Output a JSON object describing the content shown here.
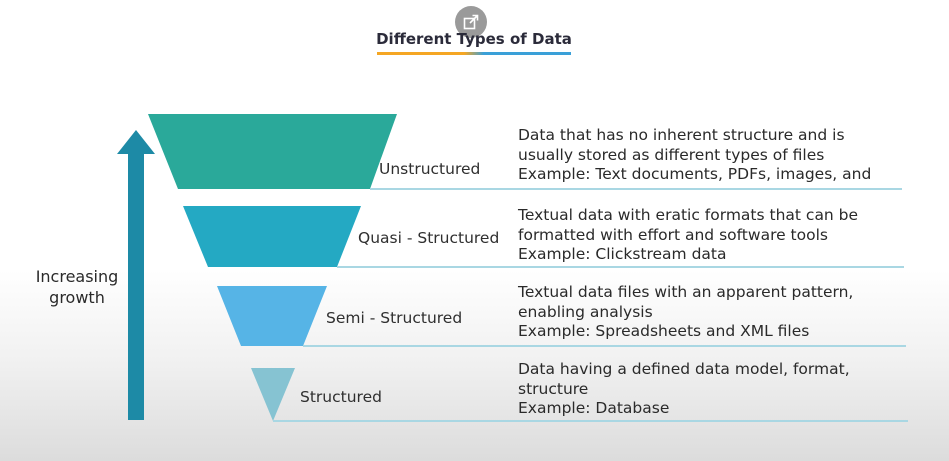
{
  "header": {
    "title": "Different Types of Data",
    "share_icon": "external-link-icon"
  },
  "axis": {
    "line1": "Increasing",
    "line2": "growth",
    "arrow_color": "#1d8aa6"
  },
  "tiers": [
    {
      "label": "Unstructured",
      "color": "#2aa99a",
      "description": [
        "Data that has no inherent structure and is",
        "usually stored as different types of files",
        "Example: Text documents, PDFs, images, and"
      ]
    },
    {
      "label": "Quasi - Structured",
      "color": "#24a9c3",
      "description": [
        "Textual data with eratic formats that can be",
        "formatted with effort and software tools",
        "Example: Clickstream data"
      ]
    },
    {
      "label": "Semi - Structured",
      "color": "#56b4e6",
      "description": [
        "Textual data files with an apparent pattern,",
        "enabling analysis",
        "Example: Spreadsheets and XML files"
      ]
    },
    {
      "label": "Structured",
      "color": "#86c3d2",
      "description": [
        "Data having a defined data model, format,",
        "structure",
        "Example: Database"
      ]
    }
  ],
  "colors": {
    "divider": "#a9d7e3",
    "title_underline_left": "#f5a623",
    "title_underline_right": "#3aa0d8"
  }
}
